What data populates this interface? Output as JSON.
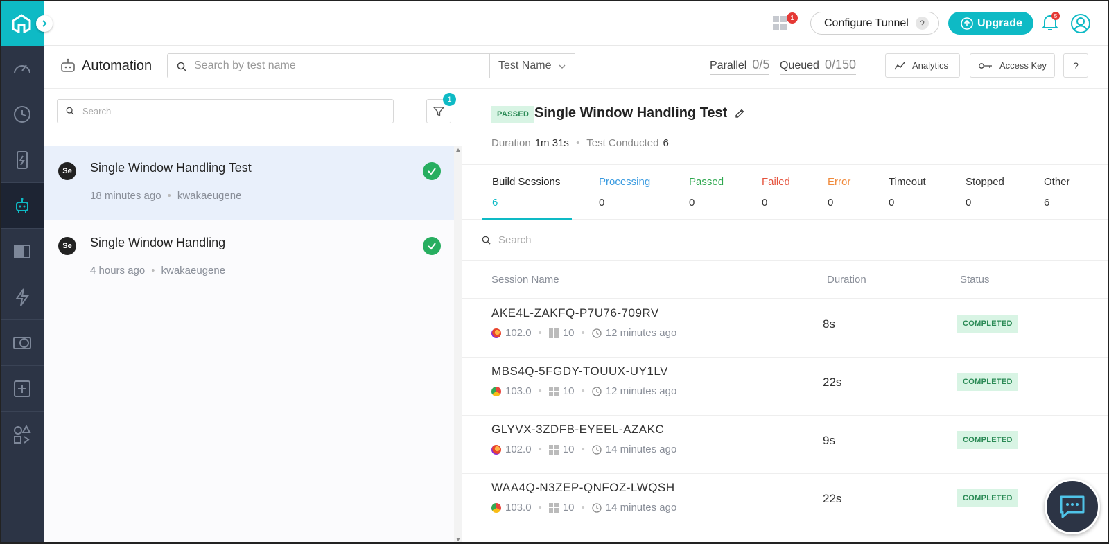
{
  "topbar": {
    "grid_badge": "1",
    "tunnel_label": "Configure Tunnel",
    "tunnel_help": "?",
    "upgrade_label": "Upgrade",
    "bell_badge": "5"
  },
  "toolbar": {
    "title": "Automation",
    "search_placeholder": "Search by test name",
    "filter_select": "Test Name",
    "parallel_label": "Parallel",
    "parallel_value": "0/5",
    "queued_label": "Queued",
    "queued_value": "0/150",
    "analytics_label": "Analytics",
    "access_key_label": "Access Key",
    "help_label": "?"
  },
  "builds_panel": {
    "search_placeholder": "Search",
    "filter_count": "1",
    "builds": [
      {
        "name": "Single Window Handling Test",
        "time": "18 minutes ago",
        "user": "kwakaeugene",
        "icon": "Se"
      },
      {
        "name": "Single Window Handling",
        "time": "4 hours ago",
        "user": "kwakaeugene",
        "icon": "Se"
      }
    ]
  },
  "detail": {
    "status_tag": "PASSED",
    "title": "Single Window Handling Test",
    "duration_label": "Duration",
    "duration_value": "1m 31s",
    "conducted_label": "Test Conducted",
    "conducted_value": "6",
    "tabs": [
      {
        "label": "Build Sessions",
        "value": "6",
        "color": "#222222"
      },
      {
        "label": "Processing",
        "value": "0",
        "color": "#3a9be0"
      },
      {
        "label": "Passed",
        "value": "0",
        "color": "#2fa84f"
      },
      {
        "label": "Failed",
        "value": "0",
        "color": "#e5533d"
      },
      {
        "label": "Error",
        "value": "0",
        "color": "#f08a3c"
      },
      {
        "label": "Timeout",
        "value": "0",
        "color": "#333333"
      },
      {
        "label": "Stopped",
        "value": "0",
        "color": "#333333"
      },
      {
        "label": "Other",
        "value": "6",
        "color": "#333333"
      }
    ],
    "search_placeholder": "Search",
    "columns": {
      "session": "Session Name",
      "duration": "Duration",
      "status": "Status"
    },
    "sessions": [
      {
        "name": "AKE4L-ZAKFQ-P7U76-709RV",
        "browser": "firefox",
        "browser_version": "102.0",
        "os_version": "10",
        "time": "12 minutes ago",
        "duration": "8s",
        "status": "COMPLETED"
      },
      {
        "name": "MBS4Q-5FGDY-TOUUX-UY1LV",
        "browser": "chrome",
        "browser_version": "103.0",
        "os_version": "10",
        "time": "12 minutes ago",
        "duration": "22s",
        "status": "COMPLETED"
      },
      {
        "name": "GLYVX-3ZDFB-EYEEL-AZAKC",
        "browser": "firefox",
        "browser_version": "102.0",
        "os_version": "10",
        "time": "14 minutes ago",
        "duration": "9s",
        "status": "COMPLETED"
      },
      {
        "name": "WAA4Q-N3ZEP-QNFOZ-LWQSH",
        "browser": "chrome",
        "browser_version": "103.0",
        "os_version": "10",
        "time": "14 minutes ago",
        "duration": "22s",
        "status": "COMPLETED"
      }
    ]
  },
  "colors": {
    "accent": "#0ebac5",
    "sidebar": "#2c3445",
    "success": "#27ae60"
  }
}
